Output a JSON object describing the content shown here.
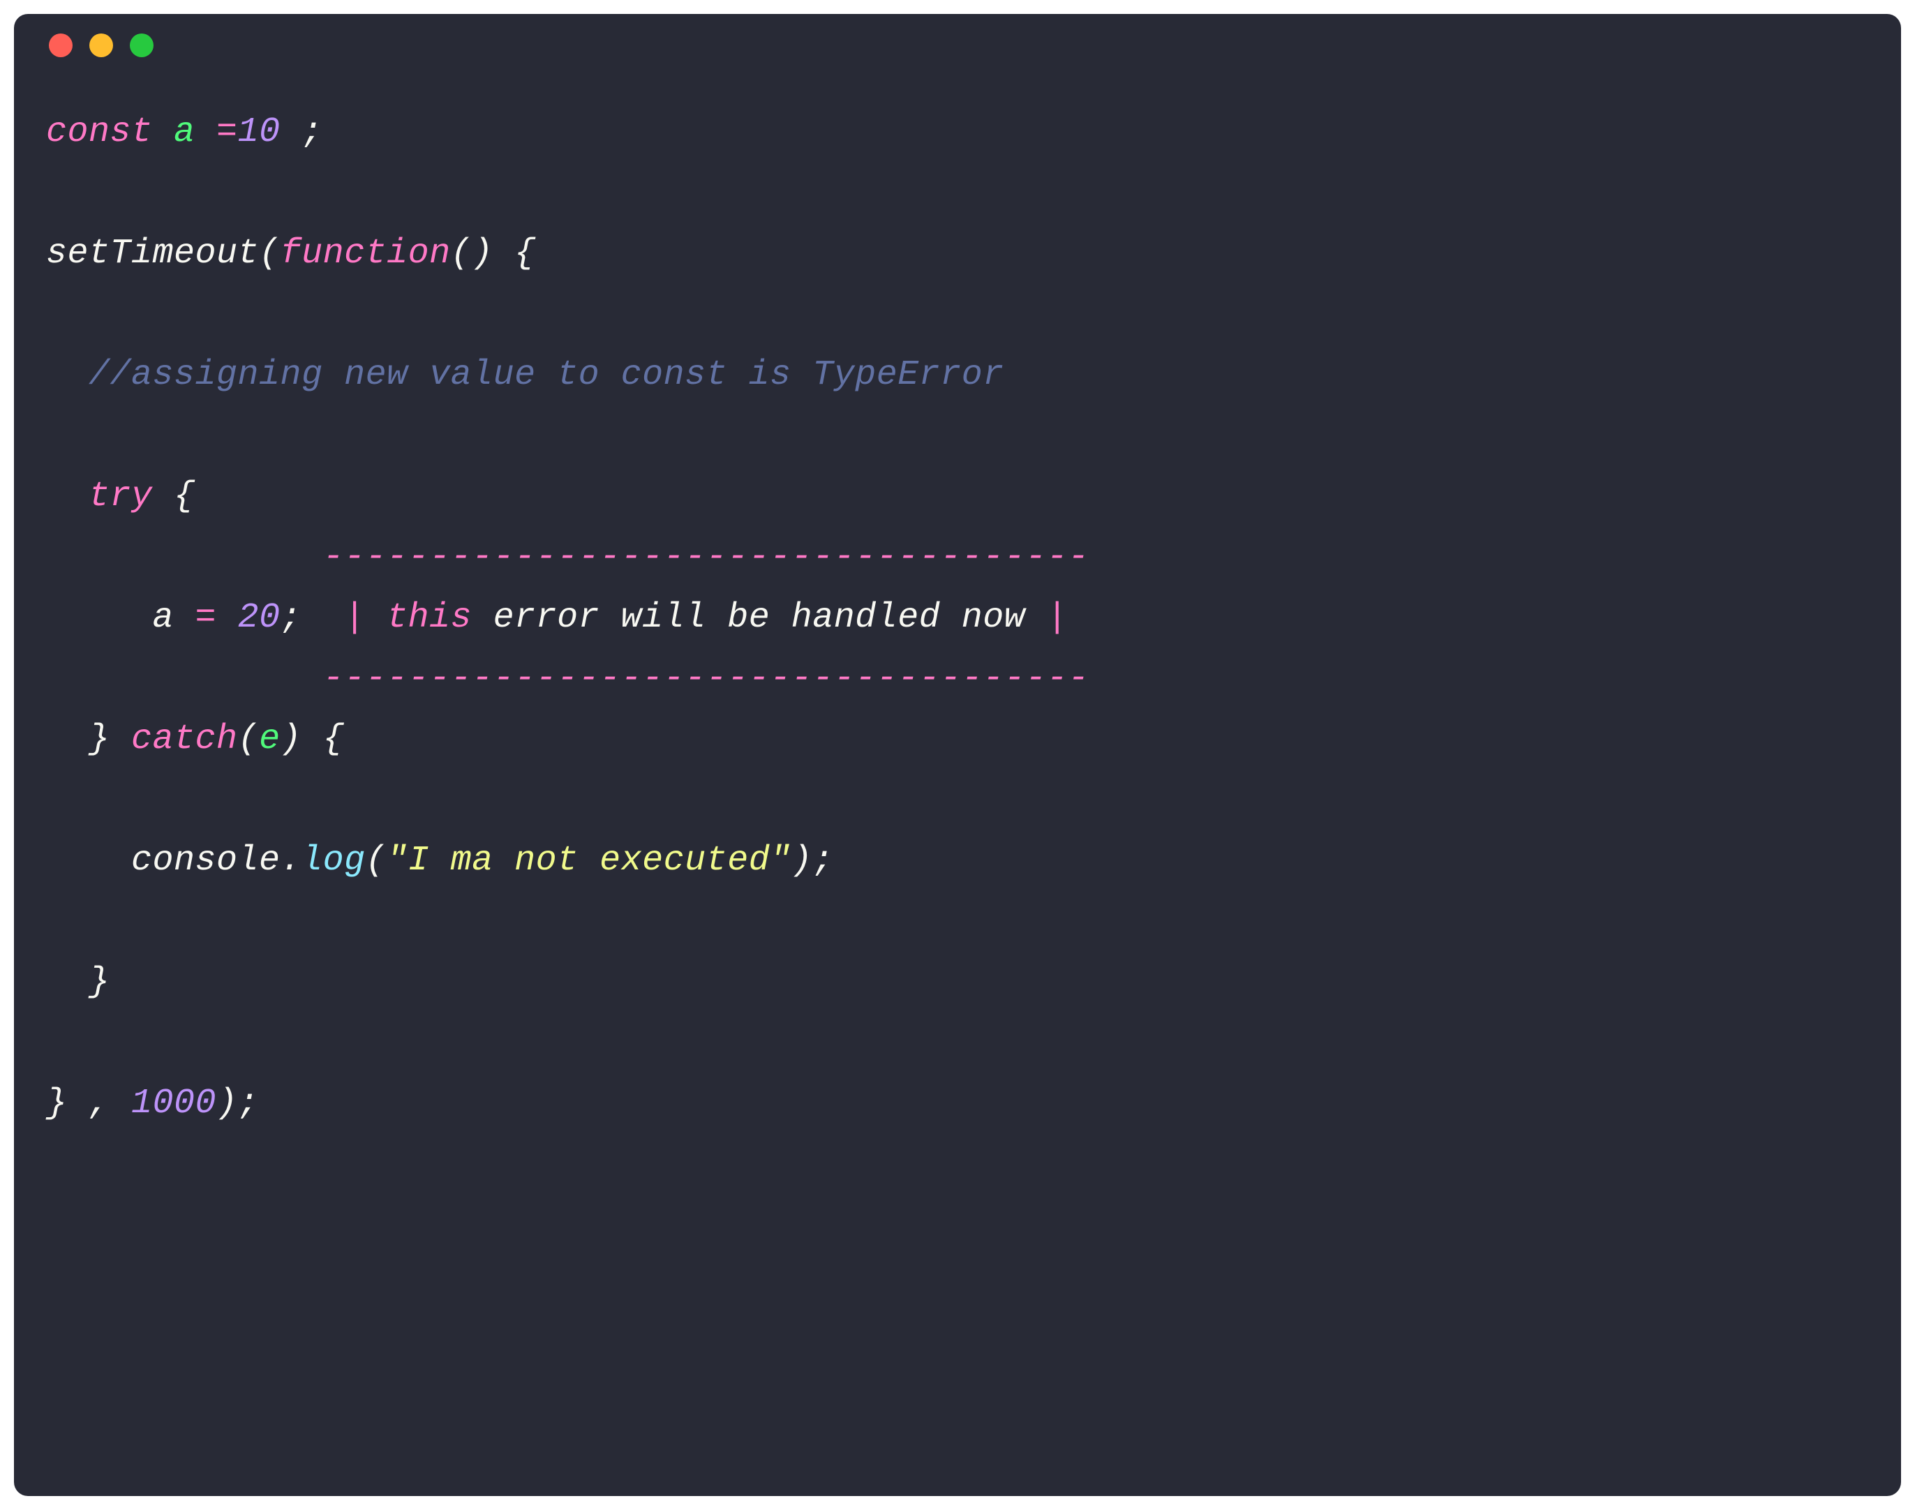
{
  "titlebar": {
    "lights": [
      "close",
      "minimize",
      "zoom"
    ]
  },
  "code": {
    "line1": {
      "const": "const ",
      "a": "a ",
      "eq": "=",
      "num": "10",
      "end": " ;"
    },
    "blank1": "",
    "line3": {
      "set": "setTimeout(",
      "func": "function",
      "rest": "() {"
    },
    "blank2": "",
    "line5": {
      "indent": "  ",
      "comment": "//assigning new value to const is TypeError"
    },
    "blank3": "",
    "line7": {
      "indent": "  ",
      "try": "try",
      "brace": " {"
    },
    "ann_top": {
      "indent": "             ",
      "dashes": "------------------------------------"
    },
    "line9": {
      "indent": "     ",
      "a": "a ",
      "eq": "= ",
      "num": "20",
      "semi": ";  ",
      "bar1": "| ",
      "this": "this ",
      "rest": "error will be handled now ",
      "bar2": "|"
    },
    "ann_bot": {
      "indent": "             ",
      "dashes": "------------------------------------"
    },
    "line11": {
      "indent": "  ",
      "close": "} ",
      "catch": "catch",
      "paren": "(",
      "e": "e",
      "rest": ") {"
    },
    "blank4": "",
    "line13": {
      "indent": "    ",
      "console": "console.",
      "log": "log",
      "open": "(",
      "str": "\"I ma not executed\"",
      "close": ");"
    },
    "blank5": "",
    "line15": {
      "indent": "  ",
      "brace": "}"
    },
    "blank6": "",
    "line17": {
      "brace": "} , ",
      "num": "1000",
      "end": ");"
    }
  }
}
